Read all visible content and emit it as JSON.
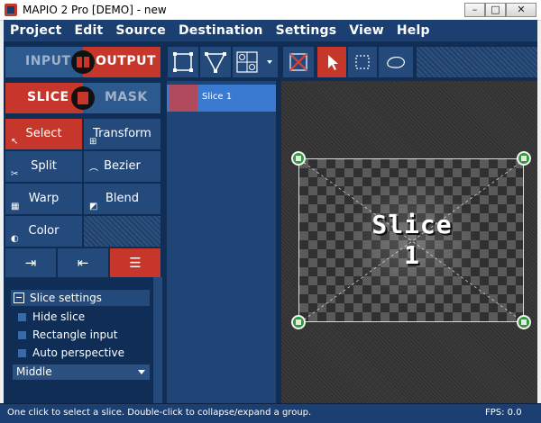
{
  "window": {
    "title": "MAPIO 2 Pro [DEMO] - new",
    "minimize": "–",
    "maximize": "□",
    "close": "✕"
  },
  "menu": [
    "Project",
    "Edit",
    "Source",
    "Destination",
    "Settings",
    "View",
    "Help"
  ],
  "left_panel": {
    "input_label": "INPUT",
    "output_label": "OUTPUT",
    "slice_label": "SLICE",
    "mask_label": "MASK",
    "tools": [
      {
        "label": "Select",
        "icon": "cursor-icon",
        "glyph": "↖",
        "active": true
      },
      {
        "label": "Transform",
        "icon": "transform-icon",
        "glyph": "⊞",
        "active": false
      },
      {
        "label": "Split",
        "icon": "split-icon",
        "glyph": "✂",
        "active": false
      },
      {
        "label": "Bezier",
        "icon": "bezier-icon",
        "glyph": "⌒",
        "active": false
      },
      {
        "label": "Warp",
        "icon": "warp-icon",
        "glyph": "▦",
        "active": false
      },
      {
        "label": "Blend",
        "icon": "blend-icon",
        "glyph": "◩",
        "active": false
      },
      {
        "label": "Color",
        "icon": "color-icon",
        "glyph": "◐",
        "active": false
      }
    ],
    "subtabs": [
      {
        "icon": "import-icon",
        "glyph": "⇥"
      },
      {
        "icon": "export-icon",
        "glyph": "⇤"
      },
      {
        "icon": "sliders-icon",
        "glyph": "☰"
      }
    ]
  },
  "settings": {
    "header": "Slice settings",
    "options": [
      "Hide slice",
      "Rectangle input",
      "Auto perspective"
    ],
    "dropdown_value": "Middle"
  },
  "slice_list": {
    "items": [
      "Slice 1"
    ]
  },
  "canvas": {
    "slice_title_line1": "Slice",
    "slice_title_line2": "1"
  },
  "status": {
    "message": "One click to select a slice. Double-click to collapse/expand a group.",
    "fps": "FPS:  0.0"
  },
  "colors": {
    "accent_red": "#c6362a",
    "navy": "#1c3f72",
    "handle_green": "#2e9a3a"
  }
}
